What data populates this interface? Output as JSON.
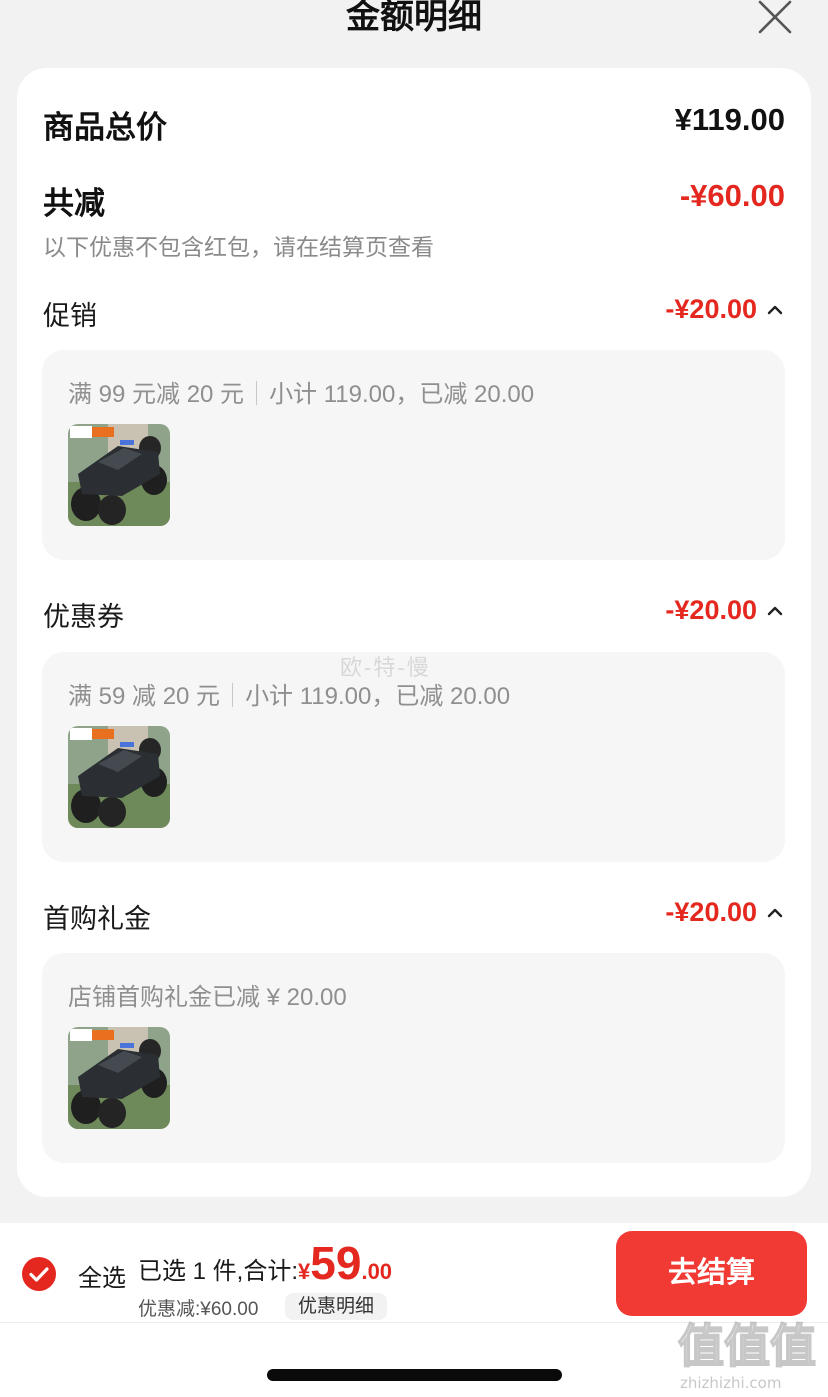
{
  "header": {
    "title": "金额明细",
    "close_icon": "close-icon"
  },
  "summary": {
    "goods_total_label": "商品总价",
    "goods_total_value": "¥119.00",
    "reduction_label": "共减",
    "reduction_value": "-¥60.00",
    "note": "以下优惠不包含红包，请在结算页查看"
  },
  "sections": [
    {
      "label": "促销",
      "value": "-¥20.00",
      "desc_a": "满 99 元减 20 元",
      "desc_b": "小计 119.00，已减 20.00",
      "product_image": "rc-monster-truck-image"
    },
    {
      "label": "优惠券",
      "value": "-¥20.00",
      "desc_a": "满 59 减 20 元",
      "desc_b": "小计 119.00，已减 20.00",
      "product_image": "rc-monster-truck-image"
    },
    {
      "label": "首购礼金",
      "value": "-¥20.00",
      "desc_a": "店铺首购礼金已减 ¥ 20.00",
      "product_image": "rc-monster-truck-image"
    }
  ],
  "watermark": "欧-特-慢",
  "bottom": {
    "select_all": "全选",
    "selected_total_label": "已选 1 件,合计:",
    "yen": "¥",
    "total_int": "59",
    "total_dec": ".00",
    "discount_text": "优惠减:¥60.00",
    "detail_button": "优惠明细",
    "checkout_button": "去结算",
    "checked": true
  },
  "site_watermark": {
    "glyphs": "值值值",
    "domain": "zhizhizhi.com"
  },
  "colors": {
    "accent_red": "#e4281f",
    "checkout_red": "#f23a35",
    "background": "#f2f2f2"
  }
}
